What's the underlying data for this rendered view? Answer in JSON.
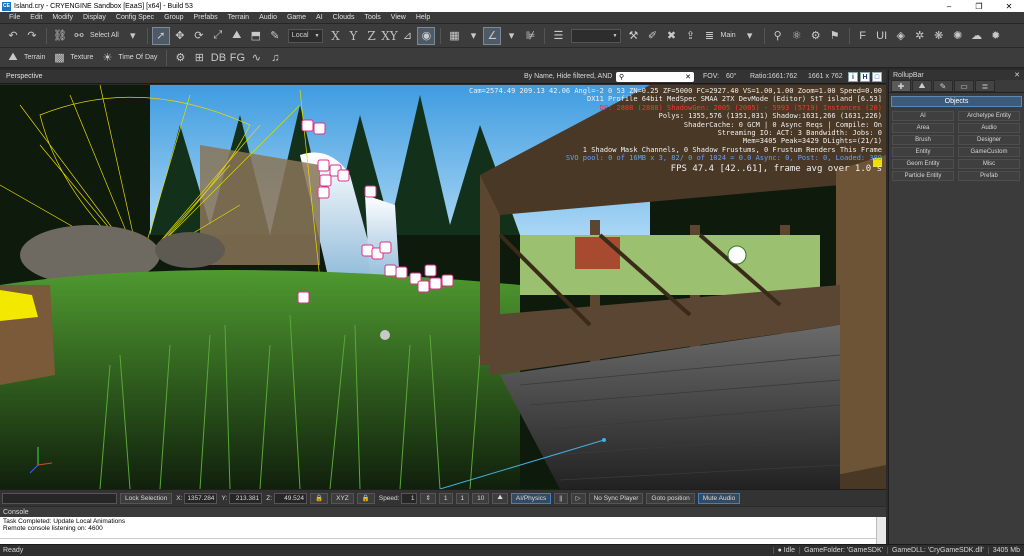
{
  "window": {
    "title": "Island.cry - CRYENGINE Sandbox [EaaS] [x64] - Build 53",
    "app_icon": "CE"
  },
  "menu": [
    "File",
    "Edit",
    "Modify",
    "Display",
    "Config Spec",
    "Group",
    "Prefabs",
    "Terrain",
    "Audio",
    "Game",
    "AI",
    "Clouds",
    "Tools",
    "View",
    "Help"
  ],
  "toolbar": {
    "select_all": "Select All",
    "coord_system": "Local",
    "axes": [
      "X",
      "Y",
      "Z",
      "XY"
    ],
    "layout": "Main",
    "terrain": "Terrain",
    "texture": "Texture",
    "time_of_day": "Time Of Day"
  },
  "viewport": {
    "title": "Perspective",
    "filter": "By Name, Hide filtered, AND",
    "search_value": "",
    "fov_label": "FOV:",
    "fov_value": "60°",
    "ratio_label": "Ratio:",
    "ratio_value": "1661:762",
    "resolution": "1661 x 762",
    "buttons": [
      "i",
      "H",
      "□"
    ],
    "stats": [
      {
        "c": "white",
        "t": "Cam=2574.49 209.13 42.06 Angl=-2  0  53 ZN=0.25 ZF=5000 FC=2927.40 VS=1.00,1.00 Zoom=1.00 Speed=0.00"
      },
      {
        "c": "white",
        "t": "DX11 Profile 64bit MedSpec SMAA 2TX DevMode (Editor) StT island [6.53]"
      },
      {
        "c": "red",
        "t": "DP: 2888 (2888) ShadowGen: 2005 (2005) - 5993 (5719) Instances (20)"
      },
      {
        "c": "white",
        "t": "Polys: 1355,576 (1351,031) Shadow:1631,266 (1631,226)"
      },
      {
        "c": "white",
        "t": "ShaderCache: 0 GCM | 0 Async Reqs | Compile: On"
      },
      {
        "c": "white",
        "t": "Streaming IO: ACT: 3  Bandwidth: Jobs: 0"
      },
      {
        "c": "white",
        "t": "Mem=3405 Peak=3429 DLights=(21/1)"
      },
      {
        "c": "white",
        "t": "1 Shadow Mask Channels,   0 Shadow Frustums,   0 Frustum Renders This Frame"
      },
      {
        "c": "blue",
        "t": "SVO pool:  0 of 16MB x 3,  82/  0 of 1024 = 0.0 Async:  0, Post:  0, Loaded:  389"
      }
    ],
    "fps": "FPS 47.4 [42..61], frame avg over 1.0 s"
  },
  "status": {
    "lock_selection": "Lock Selection",
    "x_label": "X:",
    "x_value": "1357.284",
    "y_label": "Y:",
    "y_value": "213.381",
    "z_label": "Z:",
    "z_value": "49.524",
    "xyz": "XYZ",
    "speed_label": "Speed:",
    "speed_value": "1",
    "speed_presets": [
      "1",
      "1",
      "10"
    ],
    "ai_physics": "AI/Physics",
    "no_sync": "No Sync Player",
    "goto": "Goto position",
    "mute": "Mute Audio"
  },
  "console": {
    "title": "Console",
    "lines": [
      "Task Completed: Update Local Animations",
      "Remote console listening on: 4600"
    ]
  },
  "bottom": {
    "ready": "Ready",
    "idle": "Idle",
    "game_folder": "GameFolder: 'GameSDK'",
    "game_dll": "GameDLL: 'CryGameSDK.dll'",
    "memory": "3405 Mb"
  },
  "rollup": {
    "title": "RollupBar",
    "objects": "Objects",
    "buttons": [
      "AI",
      "Archetype Entity",
      "Area",
      "Audio",
      "Brush",
      "Designer",
      "Entity",
      "GameCustom",
      "Geom Entity",
      "Misc",
      "Particle Entity",
      "Prefab"
    ]
  },
  "colors": {
    "selection_yellow": "#e8d800",
    "sky": "#4aa8e8",
    "water": "#d8e8f0",
    "wood": "#5a4632",
    "grass": "#3a7a2a",
    "entity_pink": "#e0409a"
  }
}
